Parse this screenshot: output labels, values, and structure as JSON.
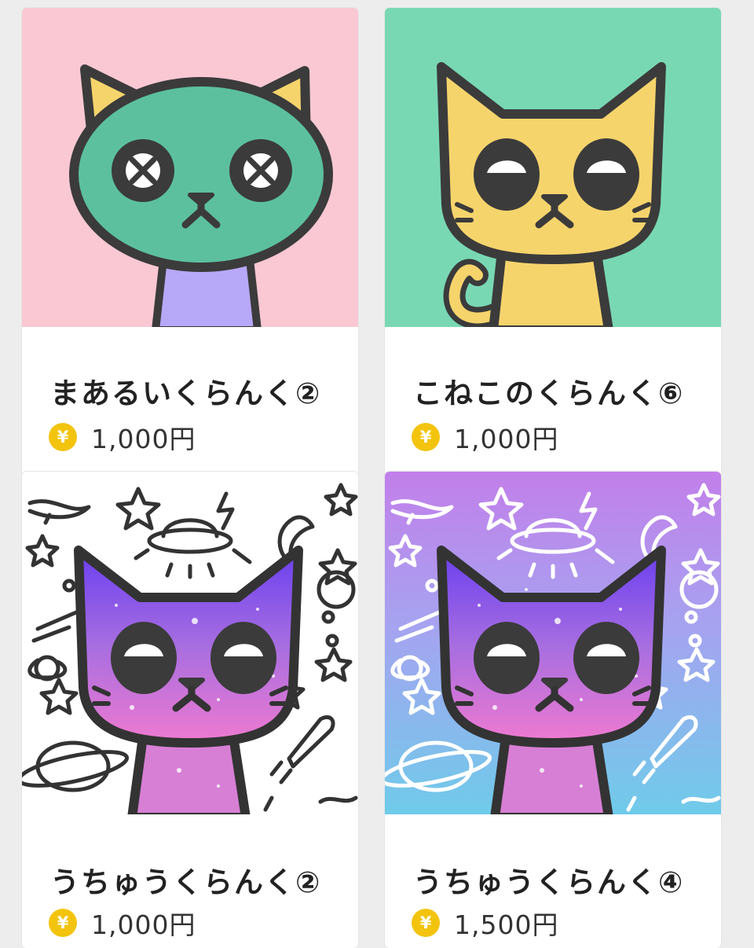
{
  "colors": {
    "pink_bg": "#f9c8d3",
    "mint_bg": "#79d8b4",
    "space_gradient": [
      "#c782ea",
      "#8fb4ee",
      "#72cdea"
    ],
    "coin": "#f3c40e",
    "outline": "#3b3b3b"
  },
  "currency_icon": {
    "glyph": "¥",
    "name": "yen-coin-icon"
  },
  "products": [
    {
      "title": "まあるいくらんく②",
      "price": "1,000円",
      "image": "green-cat-x-eyes-pink-background"
    },
    {
      "title": "こねこのくらんく⑥",
      "price": "1,000円",
      "image": "yellow-kitten-mint-background"
    },
    {
      "title": "うちゅうくらんく②",
      "price": "1,000円",
      "image": "galaxy-cat-white-space-doodles"
    },
    {
      "title": "うちゅうくらんく④",
      "price": "1,500円",
      "image": "galaxy-cat-gradient-space-doodles"
    }
  ]
}
